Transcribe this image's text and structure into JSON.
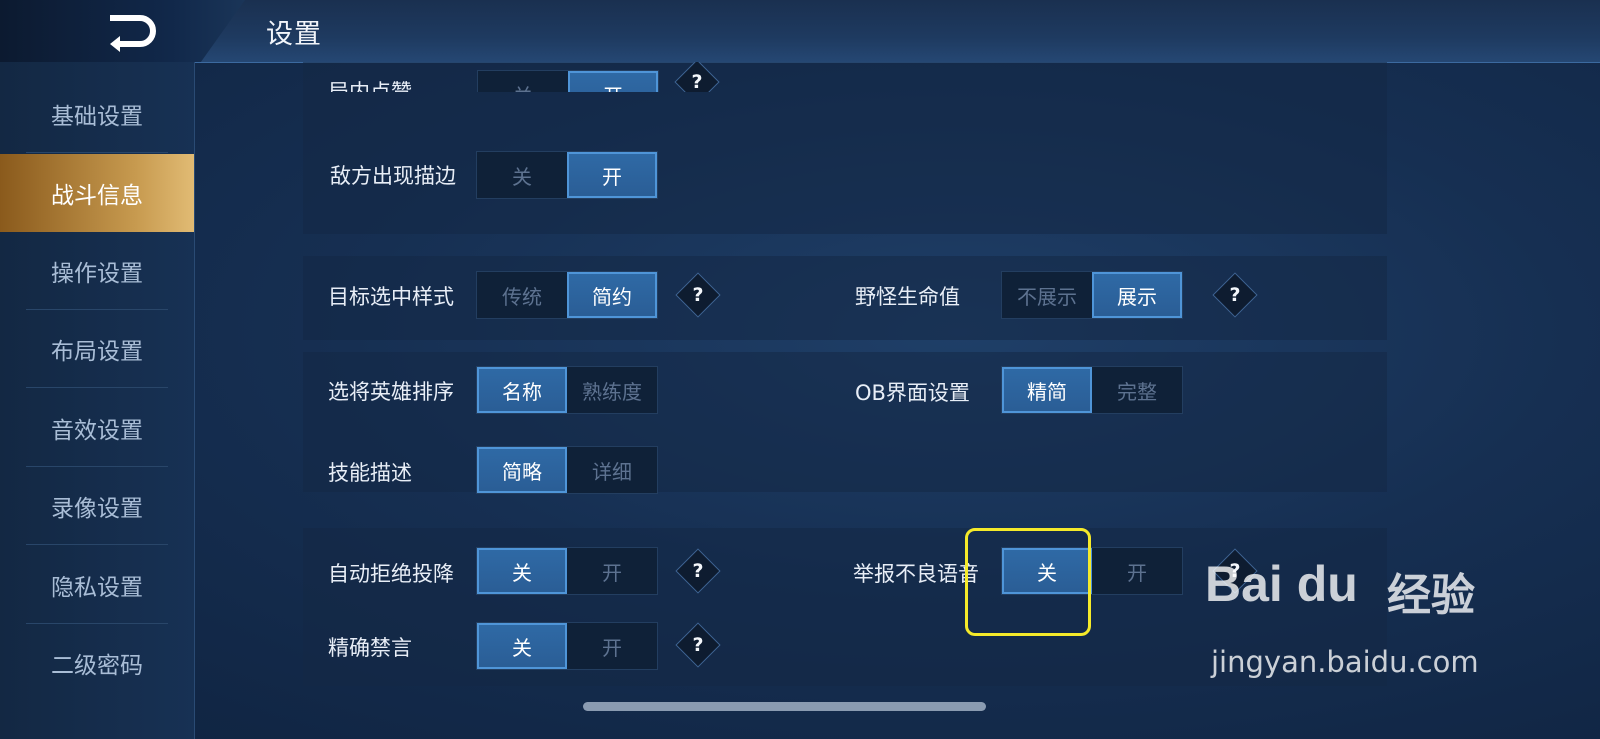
{
  "header": {
    "title": "设置",
    "back_icon": "back-arrow-icon"
  },
  "sidebar": {
    "items": [
      {
        "label": "基础设置",
        "active": false
      },
      {
        "label": "战斗信息",
        "active": true
      },
      {
        "label": "操作设置",
        "active": false
      },
      {
        "label": "布局设置",
        "active": false
      },
      {
        "label": "音效设置",
        "active": false
      },
      {
        "label": "录像设置",
        "active": false
      },
      {
        "label": "隐私设置",
        "active": false
      },
      {
        "label": "二级密码",
        "active": false
      }
    ]
  },
  "settings": {
    "in_match_like": {
      "label": "局内点赞",
      "options": [
        "关",
        "开"
      ],
      "selected": "开"
    },
    "enemy_outline": {
      "label": "敌方出现描边",
      "options": [
        "关",
        "开"
      ],
      "selected": "开"
    },
    "target_style": {
      "label": "目标选中样式",
      "options": [
        "传统",
        "简约"
      ],
      "selected": "简约"
    },
    "monster_hp": {
      "label": "野怪生命值",
      "options": [
        "不展示",
        "展示"
      ],
      "selected": "展示"
    },
    "hero_sort": {
      "label": "选将英雄排序",
      "options": [
        "名称",
        "熟练度"
      ],
      "selected": "名称"
    },
    "ob_ui": {
      "label": "OB界面设置",
      "options": [
        "精简",
        "完整"
      ],
      "selected": "精简"
    },
    "skill_desc": {
      "label": "技能描述",
      "options": [
        "简略",
        "详细"
      ],
      "selected": "简略"
    },
    "auto_reject_surrender": {
      "label": "自动拒绝投降",
      "options": [
        "关",
        "开"
      ],
      "selected": "关"
    },
    "report_bad_voice": {
      "label": "举报不良语音",
      "options": [
        "关",
        "开"
      ],
      "selected": "关"
    },
    "precise_mute": {
      "label": "精确禁言",
      "options": [
        "关",
        "开"
      ],
      "selected": "关"
    }
  },
  "help_glyph": "?",
  "watermark": {
    "logo": "Bai du",
    "suffix": "经验",
    "url": "jingyan.baidu.com"
  },
  "colors": {
    "accent_gold": "#c79a4f",
    "selected_blue": "#2f6aa6",
    "highlight_yellow": "#f5ea2a"
  }
}
